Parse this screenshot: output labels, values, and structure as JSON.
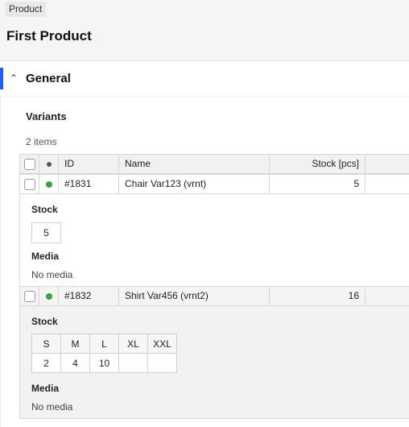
{
  "breadcrumb": {
    "chip": "Product"
  },
  "page": {
    "title": "First Product"
  },
  "section": {
    "title": "General",
    "accent_color": "#1f5fff"
  },
  "variants": {
    "title": "Variants",
    "count_text": "2 items",
    "columns": {
      "id": "ID",
      "name": "Name",
      "stock": "Stock [pcs]"
    },
    "rows": [
      {
        "id": "#1831",
        "name": "Chair Var123 (vrnt)",
        "stock": "5",
        "status_color": "#3aa23a",
        "details": {
          "stock_label": "Stock",
          "stock_value": "5",
          "media_label": "Media",
          "media_text": "No media"
        }
      },
      {
        "id": "#1832",
        "name": "Shirt Var456 (vrnt2)",
        "stock": "16",
        "status_color": "#3aa23a",
        "details": {
          "stock_label": "Stock",
          "sizes": [
            "S",
            "M",
            "L",
            "XL",
            "XXL"
          ],
          "size_values": [
            "2",
            "4",
            "10",
            "",
            ""
          ],
          "media_label": "Media",
          "media_text": "No media"
        }
      }
    ]
  }
}
